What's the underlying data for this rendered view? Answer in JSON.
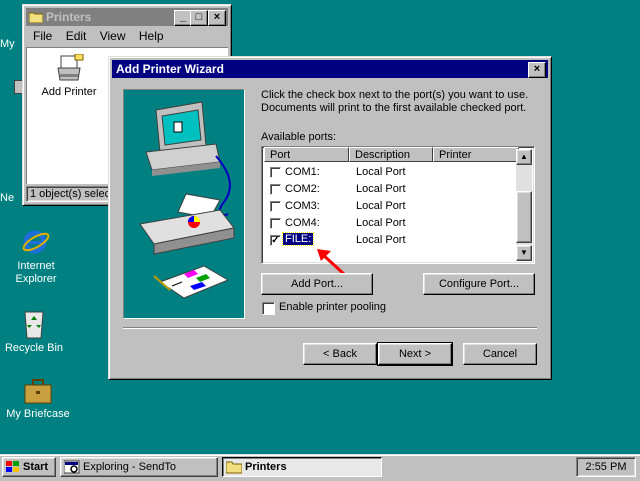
{
  "desktop": {
    "icons": [
      {
        "label": "My"
      },
      {
        "label": "Ne"
      },
      {
        "label": "Internet\nExplorer"
      },
      {
        "label": "Recycle Bin"
      },
      {
        "label": "My Briefcase"
      }
    ]
  },
  "printers_window": {
    "title": "Printers",
    "menu": [
      "File",
      "Edit",
      "View",
      "Help"
    ],
    "items": [
      {
        "label": "Add Printer"
      }
    ],
    "status": "1 object(s) select"
  },
  "wizard": {
    "title": "Add Printer Wizard",
    "instructions": "Click the check box next to the port(s) you want to use. Documents will print to the first available checked port.",
    "available_ports_label": "Available ports:",
    "columns": [
      "Port",
      "Description",
      "Printer"
    ],
    "ports": [
      {
        "port": "COM1:",
        "description": "Local Port",
        "printer": "",
        "checked": false
      },
      {
        "port": "COM2:",
        "description": "Local Port",
        "printer": "",
        "checked": false
      },
      {
        "port": "COM3:",
        "description": "Local Port",
        "printer": "",
        "checked": false
      },
      {
        "port": "COM4:",
        "description": "Local Port",
        "printer": "",
        "checked": false
      },
      {
        "port": "FILE:",
        "description": "Local Port",
        "printer": "",
        "checked": true,
        "selected": true
      }
    ],
    "add_port_label": "Add Port...",
    "configure_port_label": "Configure Port...",
    "pooling_label": "Enable printer pooling",
    "pooling_checked": false,
    "back_label": "< Back",
    "next_label": "Next >",
    "cancel_label": "Cancel"
  },
  "taskbar": {
    "start_label": "Start",
    "tasks": [
      {
        "label": "Exploring - SendTo",
        "active": false
      },
      {
        "label": "Printers",
        "active": true
      }
    ],
    "clock": "2:55 PM"
  },
  "colors": {
    "desktop": "#008080",
    "titlebar_active": "#000080",
    "titlebar_inactive": "#808080",
    "face": "#c0c0c0",
    "annotation_arrow": "#ff0000"
  }
}
